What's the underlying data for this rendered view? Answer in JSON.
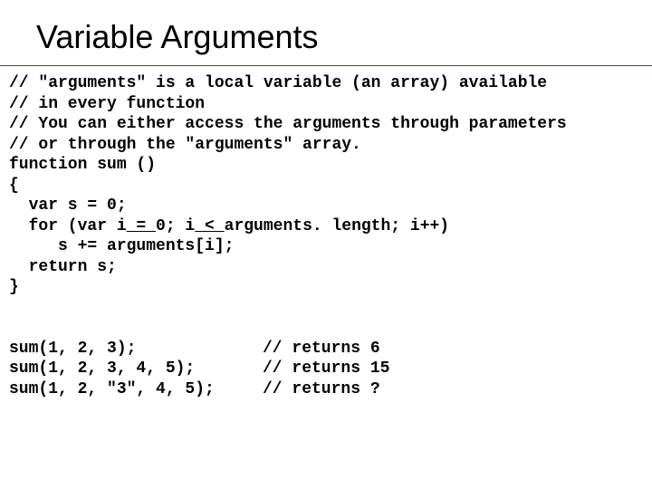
{
  "title": "Variable Arguments",
  "code": {
    "c1": "// \"arguments\" is a local variable (an array) available",
    "c2": "// in every function",
    "c3": "// You can either access the arguments through parameters",
    "c4": "// or through the \"arguments\" array.",
    "l1": "function sum ()",
    "l2": "{",
    "l3": "  var s = 0;",
    "l4a": "  for (var i",
    "l4u1": " = ",
    "l4b": "0; i",
    "l4u2": " < ",
    "l4c": "arguments. length; i++)",
    "l5": "     s += arguments[i];",
    "l6": "  return s;",
    "l7": "}",
    "blank": "",
    "r1a": "sum(1, 2, 3);",
    "r1b": "// returns 6",
    "r2a": "sum(1, 2, 3, 4, 5);",
    "r2b": "// returns 15",
    "r3a": "sum(1, 2, \"3\", 4, 5);",
    "r3b": "// returns ?"
  }
}
